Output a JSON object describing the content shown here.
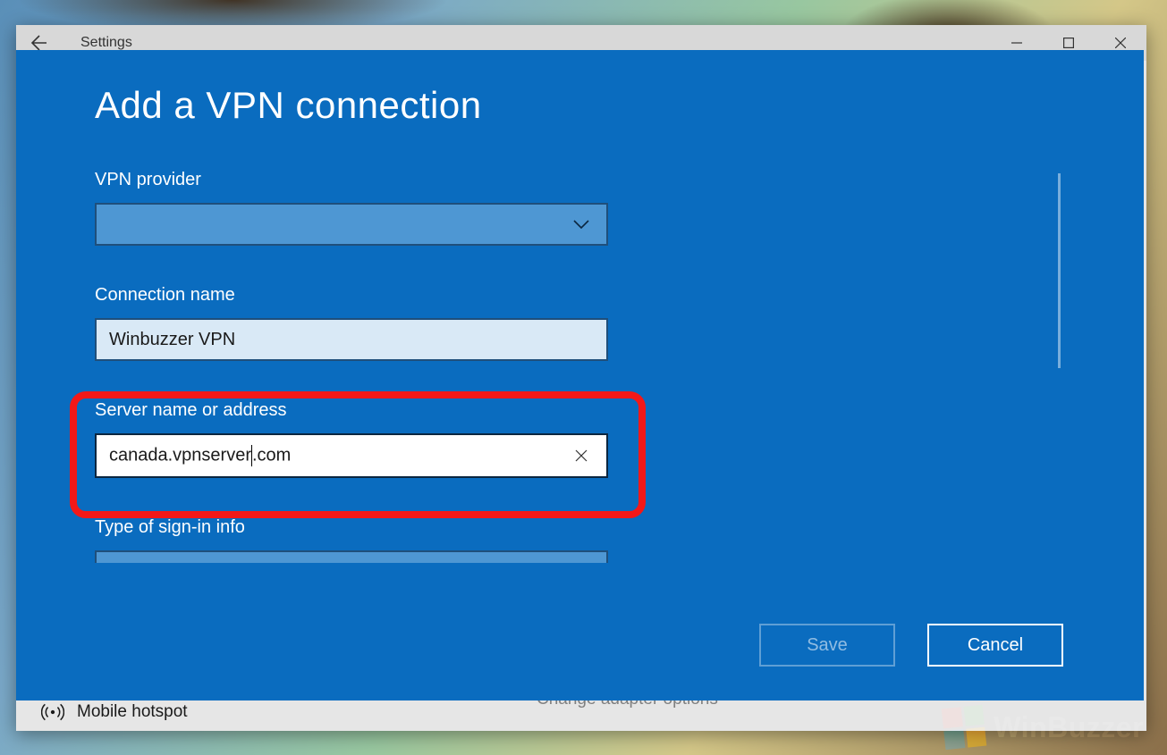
{
  "window": {
    "title": "Settings",
    "underlying": {
      "left_item": "Mobile hotspot",
      "right_link": "Change adapter options"
    }
  },
  "modal": {
    "heading": "Add a VPN connection",
    "fields": {
      "provider": {
        "label": "VPN provider",
        "value": ""
      },
      "connection_name": {
        "label": "Connection name",
        "value": "Winbuzzer VPN"
      },
      "server": {
        "label": "Server name or address",
        "value_pre": "canada.vpnserver",
        "value_post": ".com",
        "value": "canada.vpnserver.com"
      },
      "signin_type": {
        "label": "Type of sign-in info"
      }
    },
    "buttons": {
      "save": "Save",
      "cancel": "Cancel"
    }
  },
  "watermark": "WinBuzzer"
}
